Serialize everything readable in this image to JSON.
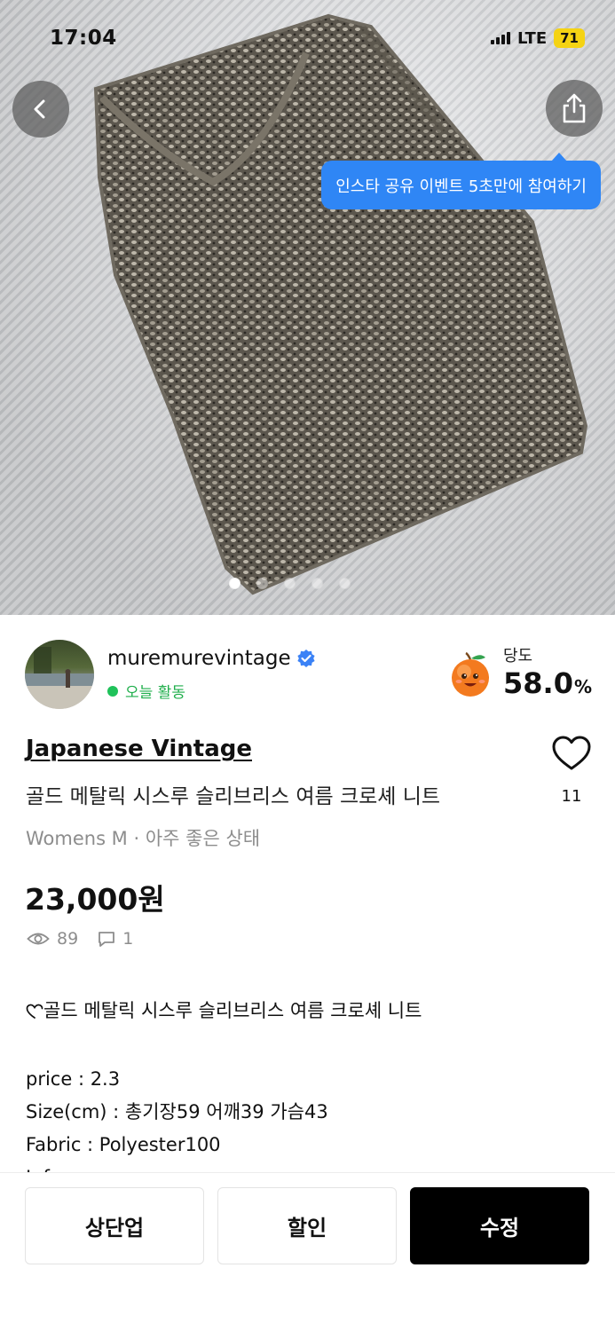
{
  "status_bar": {
    "time": "17:04",
    "network": "LTE",
    "battery": "71"
  },
  "hero": {
    "image_index": 1,
    "image_count": 5,
    "insta_tip": "인스타 공유 이벤트 5초만에 참여하기",
    "icons": {
      "back": "chevron-left-icon",
      "share": "share-icon"
    }
  },
  "seller": {
    "name": "muremurevintage",
    "verified_icon": "verified-badge-icon",
    "activity": "오늘 활동",
    "sweetness_label": "당도",
    "sweetness_value": "58.0",
    "sweetness_unit": "%"
  },
  "product": {
    "brand": "Japanese Vintage",
    "title": "골드 메탈릭 시스루 슬리브리스 여름 크로셰 니트",
    "meta": "Womens M · 아주 좋은 상태",
    "price": "23,000원",
    "likes": "11",
    "views": "89",
    "comments": "1"
  },
  "description": {
    "heading": "골드 메탈릭 시스루 슬리브리스 여름 크로셰 니트",
    "lines": [
      "price : 2.3",
      "Size(cm) : 총기장59 어깨39 가슴43",
      "Fabric : Polyester100",
      "Info :"
    ]
  },
  "actions": {
    "bump": "상단업",
    "discount": "할인",
    "edit": "수정"
  },
  "colors": {
    "primary_dark": "#000000",
    "active_green": "#1fc25a",
    "tip_blue": "#2f86f5",
    "verified_blue": "#3b82f6",
    "muted_text": "#8d8d8d"
  }
}
